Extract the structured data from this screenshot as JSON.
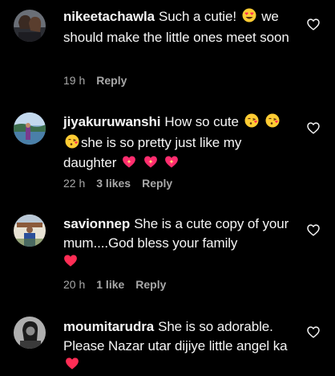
{
  "comments": [
    {
      "username": "nikeetachawla",
      "text_1": "Such a cutie!",
      "text_2": "we should make the little ones meet soon",
      "time": "19 h",
      "likes": "",
      "reply": "Reply"
    },
    {
      "username": "jiyakuruwanshi",
      "text_1": "How so cute",
      "text_2": "she is so pretty just like my daughter",
      "time": "22 h",
      "likes": "3 likes",
      "reply": "Reply"
    },
    {
      "username": "savionnep",
      "text_1": "She is a cute copy of your mum....God bless your family",
      "time": "20 h",
      "likes": "1 like",
      "reply": "Reply"
    },
    {
      "username": "moumitarudra",
      "text_1": "She is so adorable. Please Nazar utar dijiye little angel ka",
      "time": "",
      "likes": "",
      "reply": ""
    }
  ],
  "icons": {
    "like": "heart-outline-icon",
    "heart_eyes": "smiling-face-with-heart-eyes-emoji",
    "kiss": "face-blowing-kiss-emoji",
    "sparkling_heart": "sparkling-heart-emoji",
    "red_heart": "red-heart-emoji"
  },
  "colors": {
    "background": "#000000",
    "text": "#f5f5f5",
    "secondary": "#a8a8a8",
    "heart_red": "#ff2d55"
  }
}
